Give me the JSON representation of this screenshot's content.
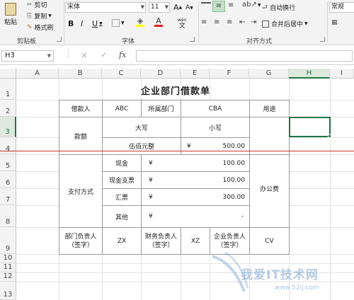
{
  "ribbon": {
    "clipboard": {
      "paste": "粘贴",
      "cut": "剪切",
      "copy": "复制",
      "format_painter": "格式刷",
      "group_label": "剪贴板"
    },
    "font": {
      "font_name": "宋体",
      "font_size": "11",
      "bold": "B",
      "italic": "I",
      "underline": "U",
      "grow": "A",
      "shrink": "A",
      "phonetic": "wén",
      "group_label": "字体"
    },
    "alignment": {
      "wrap_text": "自动换行",
      "merge_center": "合并后居中",
      "group_label": "对齐方式"
    },
    "number": {
      "format": "常规"
    }
  },
  "formula_bar": {
    "name_box": "H3",
    "cancel": "×",
    "enter": "✓",
    "fx": "fx",
    "value": ""
  },
  "grid": {
    "columns": [
      "A",
      "B",
      "C",
      "D",
      "E",
      "F",
      "G",
      "H",
      "I"
    ],
    "rows": [
      "1",
      "2",
      "3",
      "4",
      "5",
      "6",
      "7",
      "8",
      "9",
      "10",
      "11",
      "12",
      "13"
    ],
    "selected_column": "H",
    "selected_row": "3"
  },
  "sheet": {
    "title": "企业部门借款单",
    "borrower_label": "借款人",
    "borrower_value": "ABC",
    "dept_label": "所属部门",
    "dept_value": "CBA",
    "purpose_label": "用途",
    "amount_label": "款额",
    "uppercase_label": "大写",
    "lowercase_label": "小写",
    "uppercase_value": "伍佰元整",
    "lowercase_currency": "¥",
    "lowercase_value": "500.00",
    "payment_method_label": "支付方式",
    "methods": [
      {
        "name": "现金",
        "currency": "¥",
        "amount": "100.00"
      },
      {
        "name": "现金支票",
        "currency": "¥",
        "amount": "100.00"
      },
      {
        "name": "汇票",
        "currency": "¥",
        "amount": "300.00"
      },
      {
        "name": "其他",
        "currency": "¥",
        "amount": "-"
      }
    ],
    "purpose_value": "办公费",
    "dept_head_label": "部门负责人\n（签字）",
    "dept_head_value": "ZX",
    "finance_head_label": "财务负责人\n（签字）",
    "finance_head_value": "XZ",
    "company_head_label": "企业负责人\n（签字）",
    "company_head_value": "CV"
  },
  "watermark": {
    "text": "我爱IT技术网",
    "url": "www.52ij.com"
  },
  "colors": {
    "accent": "#217346",
    "border": "#9a9a9a",
    "red_line": "#c0392b"
  }
}
